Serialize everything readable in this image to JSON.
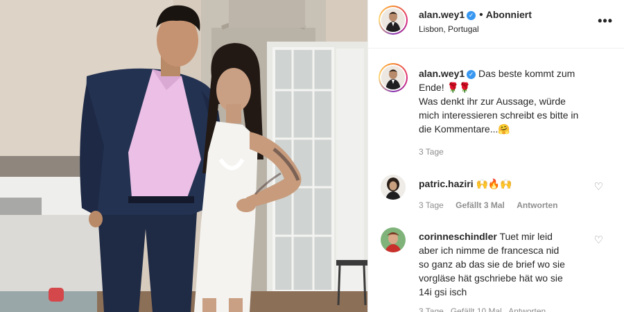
{
  "post": {
    "author": "alan.wey1",
    "verified_icon": "✓",
    "follow_dot": "•",
    "follow_status": "Abonniert",
    "location": "Lisbon, Portugal",
    "more_icon": "•••"
  },
  "caption": {
    "author": "alan.wey1",
    "line1": "Das beste kommt zum",
    "line2": "Ende! 🌹🌹",
    "line3": "Was denkt ihr zur Aussage, würde",
    "line4": "mich interessieren schreibt es bitte in",
    "line5": "die Kommentare...🤗",
    "time": "3 Tage"
  },
  "comments": [
    {
      "author": "patric.haziri",
      "text": "🙌🔥🙌",
      "time": "3 Tage",
      "likes": "Gefällt 3 Mal",
      "reply": "Antworten"
    },
    {
      "author": "corinneschindler",
      "line1": "Tuet mir leid",
      "line2": "aber ich nimme de francesca nid",
      "line3": "so ganz ab das sie de brief wo sie",
      "line4": "vorgläse hät gschriebe hät wo sie",
      "line5": "14i gsi isch",
      "partial_meta": "3 Tage   Gefällt 10 Mal   Antworten"
    }
  ],
  "icons": {
    "heart": "♡"
  },
  "colors": {
    "verified": "#3897f0",
    "meta": "#8e8e8e",
    "text": "#262626"
  }
}
